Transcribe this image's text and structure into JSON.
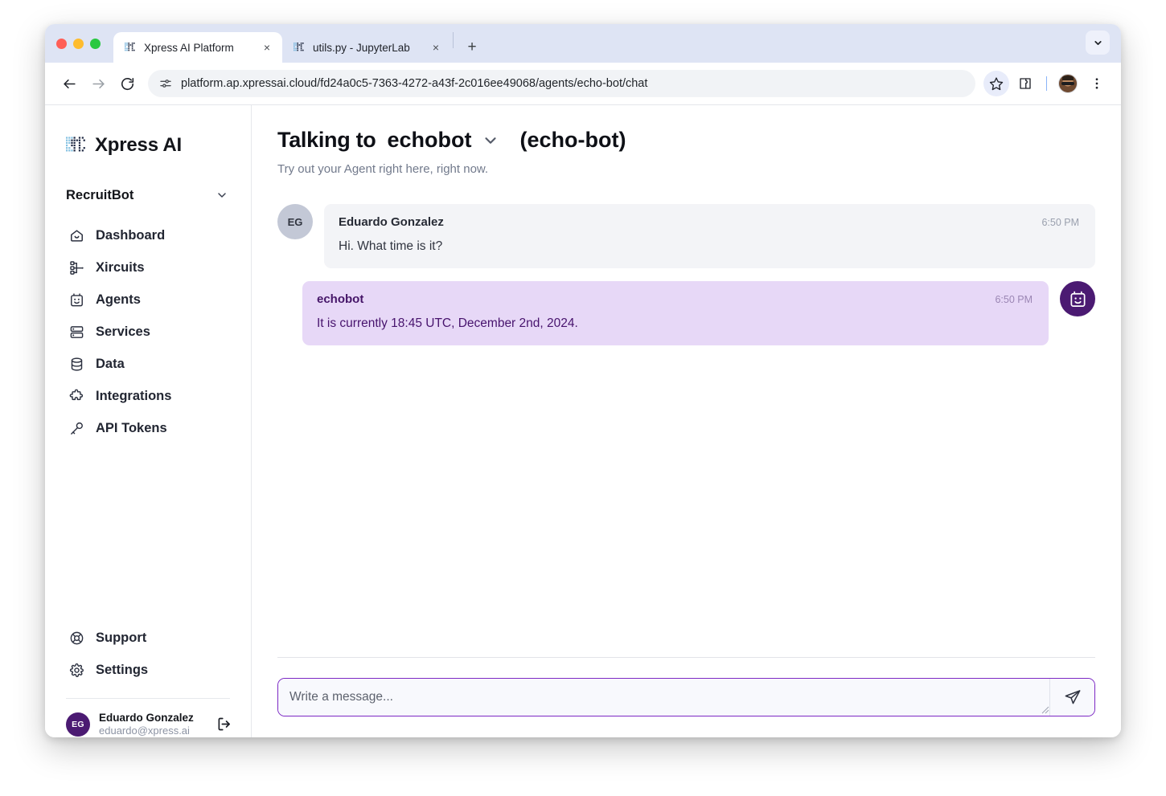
{
  "browser": {
    "tabs": [
      {
        "title": "Xpress AI Platform",
        "favicon": "xpress-dot-matrix-favicon",
        "active": true,
        "close_label": "×"
      },
      {
        "title": "utils.py - JupyterLab",
        "favicon": "xpress-dot-matrix-favicon",
        "active": false,
        "close_label": "×"
      }
    ],
    "new_tab_label": "+",
    "tab_search_icon": "chevron-down-icon",
    "toolbar": {
      "back_icon": "back-arrow-icon",
      "forward_icon": "forward-arrow-icon",
      "reload_icon": "reload-icon",
      "site_info_icon": "site-settings-icon",
      "url": "platform.ap.xpressai.cloud/fd24a0c5-7363-4272-a43f-2c016ee49068/agents/echo-bot/chat",
      "bookmark_icon": "star-icon",
      "extensions_icon": "extensions-puzzle-icon",
      "profile_icon": "profile-avatar",
      "menu_icon": "three-dot-menu-icon"
    }
  },
  "sidebar": {
    "brand": "Xpress AI",
    "brand_logo": "xpress-dot-matrix-logo",
    "workspace": {
      "name": "RecruitBot",
      "chevron": "chevron-down-icon"
    },
    "nav": [
      {
        "label": "Dashboard",
        "icon": "home-icon"
      },
      {
        "label": "Xircuits",
        "icon": "node-tree-icon"
      },
      {
        "label": "Agents",
        "icon": "bot-face-icon"
      },
      {
        "label": "Services",
        "icon": "server-icon"
      },
      {
        "label": "Data",
        "icon": "database-icon"
      },
      {
        "label": "Integrations",
        "icon": "puzzle-piece-icon"
      },
      {
        "label": "API Tokens",
        "icon": "key-icon"
      }
    ],
    "nav_bottom": [
      {
        "label": "Support",
        "icon": "lifebuoy-icon"
      },
      {
        "label": "Settings",
        "icon": "gear-icon"
      }
    ],
    "user": {
      "initials": "EG",
      "name": "Eduardo Gonzalez",
      "email": "eduardo@xpress.ai",
      "logout_icon": "logout-icon"
    }
  },
  "chat": {
    "title_prefix": "Talking to",
    "agent_name": "echobot",
    "agent_chevron": "chevron-down-icon",
    "agent_id": "(echo-bot)",
    "subtitle": "Try out your Agent right here, right now.",
    "messages": [
      {
        "role": "user",
        "avatar_initials": "EG",
        "avatar_icon": "user-initials-avatar",
        "sender": "Eduardo Gonzalez",
        "time": "6:50 PM",
        "text": "Hi. What time is it?"
      },
      {
        "role": "bot",
        "avatar_initials": "",
        "avatar_icon": "bot-face-icon",
        "sender": "echobot",
        "time": "6:50 PM",
        "text": "It is currently 18:45 UTC, December 2nd, 2024."
      }
    ],
    "composer": {
      "placeholder": "Write a message...",
      "value": "",
      "send_icon": "send-paper-plane-icon"
    }
  },
  "colors": {
    "accent_purple": "#7c28c4",
    "bot_bubble": "#e7d8f7",
    "bot_text": "#47136d",
    "avatar_purple": "#4b1a72",
    "user_bubble": "#f3f4f7",
    "tabstrip": "#dee4f4"
  }
}
